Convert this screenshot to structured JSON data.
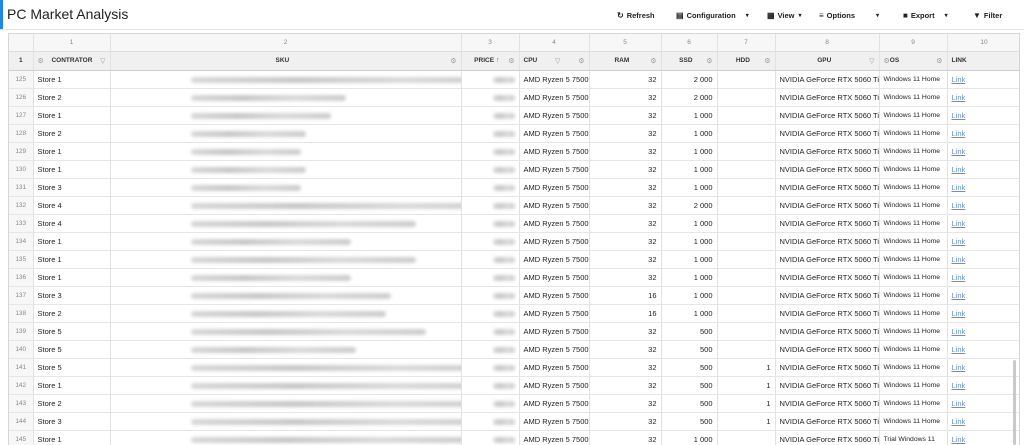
{
  "app": {
    "title": "PC Market Analysis"
  },
  "toolbar": {
    "refresh": "Refresh",
    "configuration": "Configuration",
    "view": "View",
    "options": "Options",
    "export": "Export",
    "filter": "Filter"
  },
  "colors": {
    "accent": "#1e88e5",
    "link": "#5b8fd8"
  },
  "column_numbers": [
    "1",
    "2",
    "3",
    "4",
    "5",
    "6",
    "7",
    "8",
    "9",
    "10"
  ],
  "corner_number": "1",
  "headers": {
    "contrator": "CONTRATOR",
    "sku": "SKU",
    "price": "PRICE",
    "cpu": "CPU",
    "ram": "RAM",
    "ssd": "SSD",
    "hdd": "HDD",
    "gpu": "GPU",
    "os": "OS",
    "link": "LINK"
  },
  "rows": [
    {
      "n": "125",
      "store": "Store 1",
      "cpu": "AMD Ryzen 5 7500F",
      "ram": "32",
      "ssd": "2 000",
      "hdd": "",
      "gpu": "NVIDIA GeForce RTX 5060 Ti",
      "os": "Windows 11 Home",
      "link": "Link",
      "sku_w": 320,
      "price_w": 22
    },
    {
      "n": "126",
      "store": "Store 2",
      "cpu": "AMD Ryzen 5 7500F",
      "ram": "32",
      "ssd": "2 000",
      "hdd": "",
      "gpu": "NVIDIA GeForce RTX 5060 Ti",
      "os": "Windows 11 Home",
      "link": "Link",
      "sku_w": 155,
      "price_w": 22
    },
    {
      "n": "127",
      "store": "Store 1",
      "cpu": "AMD Ryzen 5 7500F",
      "ram": "32",
      "ssd": "1 000",
      "hdd": "",
      "gpu": "NVIDIA GeForce RTX 5060 Ti",
      "os": "Windows 11 Home",
      "link": "Link",
      "sku_w": 140,
      "price_w": 22
    },
    {
      "n": "128",
      "store": "Store 2",
      "cpu": "AMD Ryzen 5 7500F",
      "ram": "32",
      "ssd": "1 000",
      "hdd": "",
      "gpu": "NVIDIA GeForce RTX 5060 Ti",
      "os": "Windows 11 Home",
      "link": "Link",
      "sku_w": 115,
      "price_w": 22
    },
    {
      "n": "129",
      "store": "Store 1",
      "cpu": "AMD Ryzen 5 7500F",
      "ram": "32",
      "ssd": "1 000",
      "hdd": "",
      "gpu": "NVIDIA GeForce RTX 5060 Ti",
      "os": "Windows 11 Home",
      "link": "Link",
      "sku_w": 110,
      "price_w": 22
    },
    {
      "n": "130",
      "store": "Store 1",
      "cpu": "AMD Ryzen 5 7500F",
      "ram": "32",
      "ssd": "1 000",
      "hdd": "",
      "gpu": "NVIDIA GeForce RTX 5060 Ti",
      "os": "Windows 11 Home",
      "link": "Link",
      "sku_w": 115,
      "price_w": 22
    },
    {
      "n": "131",
      "store": "Store 3",
      "cpu": "AMD Ryzen 5 7500F",
      "ram": "32",
      "ssd": "1 000",
      "hdd": "",
      "gpu": "NVIDIA GeForce RTX 5060 Ti",
      "os": "Windows 11 Home",
      "link": "Link",
      "sku_w": 110,
      "price_w": 22
    },
    {
      "n": "132",
      "store": "Store 4",
      "cpu": "AMD Ryzen 5 7500F",
      "ram": "32",
      "ssd": "2 000",
      "hdd": "",
      "gpu": "NVIDIA GeForce RTX 5060 Ti",
      "os": "Windows 11 Home",
      "link": "Link",
      "sku_w": 320,
      "price_w": 22
    },
    {
      "n": "133",
      "store": "Store 4",
      "cpu": "AMD Ryzen 5 7500F",
      "ram": "32",
      "ssd": "1 000",
      "hdd": "",
      "gpu": "NVIDIA GeForce RTX 5060 Ti",
      "os": "Windows 11 Home",
      "link": "Link",
      "sku_w": 225,
      "price_w": 22
    },
    {
      "n": "134",
      "store": "Store 1",
      "cpu": "AMD Ryzen 5 7500F",
      "ram": "32",
      "ssd": "1 000",
      "hdd": "",
      "gpu": "NVIDIA GeForce RTX 5060 Ti",
      "os": "Windows 11 Home",
      "link": "Link",
      "sku_w": 160,
      "price_w": 22
    },
    {
      "n": "135",
      "store": "Store 1",
      "cpu": "AMD Ryzen 5 7500F",
      "ram": "32",
      "ssd": "1 000",
      "hdd": "",
      "gpu": "NVIDIA GeForce RTX 5060 Ti",
      "os": "Windows 11 Home",
      "link": "Link",
      "sku_w": 225,
      "price_w": 22
    },
    {
      "n": "136",
      "store": "Store 1",
      "cpu": "AMD Ryzen 5 7500F",
      "ram": "32",
      "ssd": "1 000",
      "hdd": "",
      "gpu": "NVIDIA GeForce RTX 5060 Ti",
      "os": "Windows 11 Home",
      "link": "Link",
      "sku_w": 160,
      "price_w": 22
    },
    {
      "n": "137",
      "store": "Store 3",
      "cpu": "AMD Ryzen 5 7500F",
      "ram": "16",
      "ssd": "1 000",
      "hdd": "",
      "gpu": "NVIDIA GeForce RTX 5060 Ti",
      "os": "Windows 11 Home",
      "link": "Link",
      "sku_w": 200,
      "price_w": 22
    },
    {
      "n": "138",
      "store": "Store 2",
      "cpu": "AMD Ryzen 5 7500F",
      "ram": "16",
      "ssd": "1 000",
      "hdd": "",
      "gpu": "NVIDIA GeForce RTX 5060 Ti",
      "os": "Windows 11 Home",
      "link": "Link",
      "sku_w": 195,
      "price_w": 22
    },
    {
      "n": "139",
      "store": "Store 5",
      "cpu": "AMD Ryzen 5 7500F",
      "ram": "32",
      "ssd": "500",
      "hdd": "",
      "gpu": "NVIDIA GeForce RTX 5060 Ti",
      "os": "Windows 11 Home",
      "link": "Link",
      "sku_w": 235,
      "price_w": 22
    },
    {
      "n": "140",
      "store": "Store 5",
      "cpu": "AMD Ryzen 5 7500F",
      "ram": "32",
      "ssd": "500",
      "hdd": "",
      "gpu": "NVIDIA GeForce RTX 5060 Ti",
      "os": "Windows 11 Home",
      "link": "Link",
      "sku_w": 165,
      "price_w": 22
    },
    {
      "n": "141",
      "store": "Store 5",
      "cpu": "AMD Ryzen 5 7500F",
      "ram": "32",
      "ssd": "500",
      "hdd": "1",
      "gpu": "NVIDIA GeForce RTX 5060 Ti",
      "os": "Windows 11 Home",
      "link": "Link",
      "sku_w": 310,
      "price_w": 22
    },
    {
      "n": "142",
      "store": "Store 1",
      "cpu": "AMD Ryzen 5 7500F",
      "ram": "32",
      "ssd": "500",
      "hdd": "1",
      "gpu": "NVIDIA GeForce RTX 5060 Ti",
      "os": "Windows 11 Home",
      "link": "Link",
      "sku_w": 310,
      "price_w": 22
    },
    {
      "n": "143",
      "store": "Store 2",
      "cpu": "AMD Ryzen 5 7500F",
      "ram": "32",
      "ssd": "500",
      "hdd": "1",
      "gpu": "NVIDIA GeForce RTX 5060 Ti",
      "os": "Windows 11 Home",
      "link": "Link",
      "sku_w": 310,
      "price_w": 22
    },
    {
      "n": "144",
      "store": "Store 3",
      "cpu": "AMD Ryzen 5 7500F",
      "ram": "32",
      "ssd": "500",
      "hdd": "1",
      "gpu": "NVIDIA GeForce RTX 5060 Ti",
      "os": "Windows 11 Home",
      "link": "Link",
      "sku_w": 310,
      "price_w": 22
    },
    {
      "n": "145",
      "store": "Store 1",
      "cpu": "AMD Ryzen 5 7500F",
      "ram": "32",
      "ssd": "1 000",
      "hdd": "",
      "gpu": "NVIDIA GeForce RTX 5060 Ti",
      "os": "Trial Windows 11",
      "link": "Link",
      "sku_w": 285,
      "price_w": 22
    }
  ]
}
